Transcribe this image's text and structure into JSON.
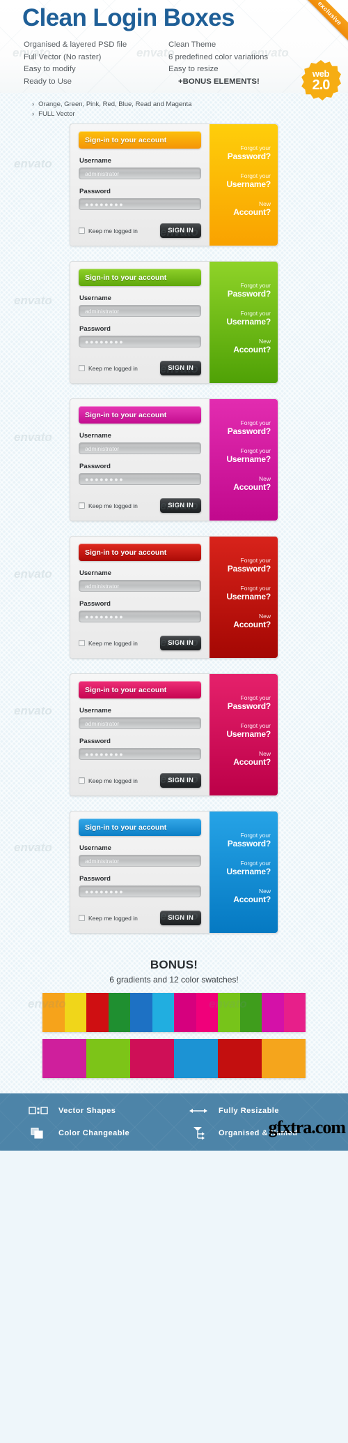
{
  "header": {
    "title": "Clean Login Boxes",
    "ribbon": "exclusive",
    "badge_line1": "web",
    "badge_line2": "2.0",
    "features_left": [
      "Organised & layered PSD file",
      "Full Vector (No raster)",
      "Easy to modify",
      "Ready to Use"
    ],
    "features_right": [
      "Clean Theme",
      "6 predefined color variations",
      "Easy to resize",
      "+BONUS ELEMENTS!"
    ]
  },
  "bullets": [
    "Orange, Green, Pink, Red, Blue, Read and Magenta",
    "FULL Vector"
  ],
  "box_common": {
    "signin_title": "Sign-in to your account",
    "username_label": "Username",
    "username_value": "administrator",
    "password_label": "Password",
    "password_value": "●●●●●●●●",
    "keep_label": "Keep me logged in",
    "signin_button": "SIGN IN",
    "link1_top": "Forgot your",
    "link1_bottom": "Password?",
    "link2_top": "Forgot your",
    "link2_bottom": "Username?",
    "link3_top": "New",
    "link3_bottom": "Account?"
  },
  "boxes": [
    {
      "name": "orange",
      "bar_from": "#fcc00d",
      "bar_to": "#f59406",
      "panel_from": "#fece0b",
      "panel_to": "#f9a200"
    },
    {
      "name": "green",
      "bar_from": "#8fd029",
      "bar_to": "#5fa70c",
      "panel_from": "#8fd328",
      "panel_to": "#4fa106"
    },
    {
      "name": "magenta",
      "bar_from": "#e638b4",
      "bar_to": "#c30c8f",
      "panel_from": "#e22cb0",
      "panel_to": "#c1098d"
    },
    {
      "name": "red",
      "bar_from": "#e02a20",
      "bar_to": "#ab0b06",
      "panel_from": "#d8231b",
      "panel_to": "#a40703"
    },
    {
      "name": "pink",
      "bar_from": "#ee2f77",
      "bar_to": "#c60451",
      "panel_from": "#e5216b",
      "panel_to": "#bc0048"
    },
    {
      "name": "blue",
      "bar_from": "#34a8e8",
      "bar_to": "#0c7fc6",
      "panel_from": "#26a3e6",
      "panel_to": "#0579c2"
    }
  ],
  "bonus": {
    "title": "BONUS!",
    "subtitle": "6 gradients and 12 color swatches!",
    "row1": [
      "#f6a31b",
      "#f0d61a",
      "#cf0f12",
      "#1f8f30",
      "#1d71c4",
      "#21aee0",
      "#d6007e",
      "#f0007a",
      "#77c41a",
      "#3f9d1c",
      "#d411a8",
      "#e71f8a"
    ],
    "row2": [
      "#cf1f9c",
      "#7dc418",
      "#cf0f57",
      "#1c93d4",
      "#c30f0f",
      "#f5a51c"
    ]
  },
  "footer": {
    "items": [
      {
        "icon": "vector-shapes-icon",
        "label": "Vector Shapes"
      },
      {
        "icon": "resize-arrows-icon",
        "label": "Fully Resizable"
      },
      {
        "icon": "color-swap-icon",
        "label": "Color Changeable"
      },
      {
        "icon": "layers-tree-icon",
        "label": "Organised & Named"
      }
    ]
  },
  "watermark": "envato",
  "gfxtra": "gfxtra.com"
}
